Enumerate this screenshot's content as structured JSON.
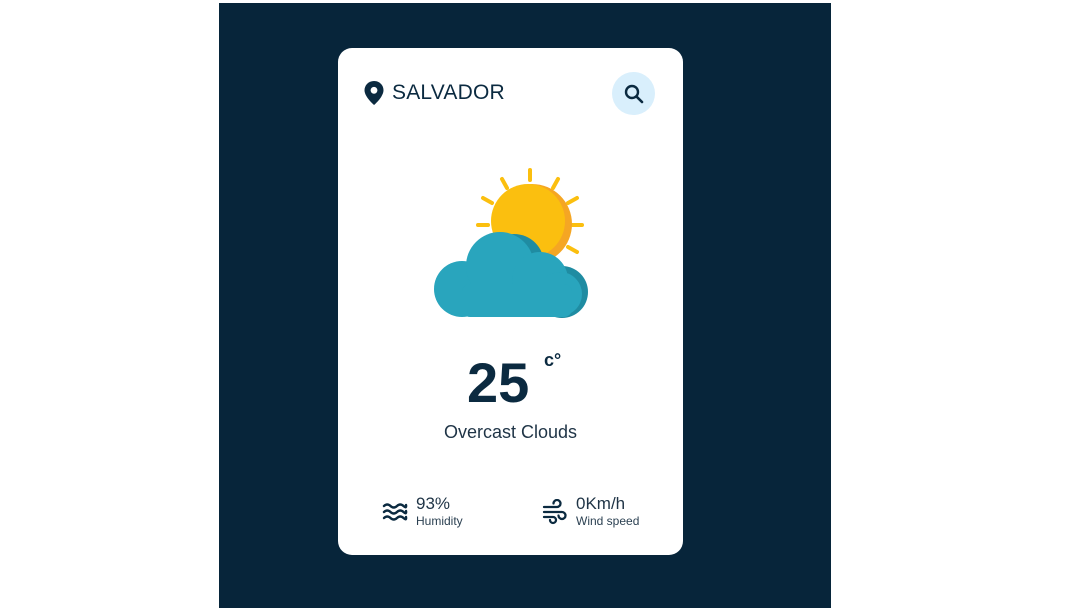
{
  "card": {
    "city": "SALVADOR",
    "temperature": "25",
    "unit": "c°",
    "condition": "Overcast Clouds",
    "weather_icon": "sun-behind-cloud-icon"
  },
  "search": {
    "icon": "search-icon"
  },
  "stats": {
    "humidity": {
      "value": "93%",
      "label": "Humidity",
      "icon": "humidity-waves-icon"
    },
    "wind": {
      "value": "0Km/h",
      "label": "Wind speed",
      "icon": "wind-icon"
    }
  },
  "colors": {
    "background": "#07253a",
    "card": "#ffffff",
    "text_dark": "#0b2a40",
    "search_button": "#d9effc",
    "sun": "#fbbf0f",
    "sun_shade": "#f5a623",
    "cloud": "#29a5bd",
    "cloud_shade": "#1f8ca2"
  }
}
